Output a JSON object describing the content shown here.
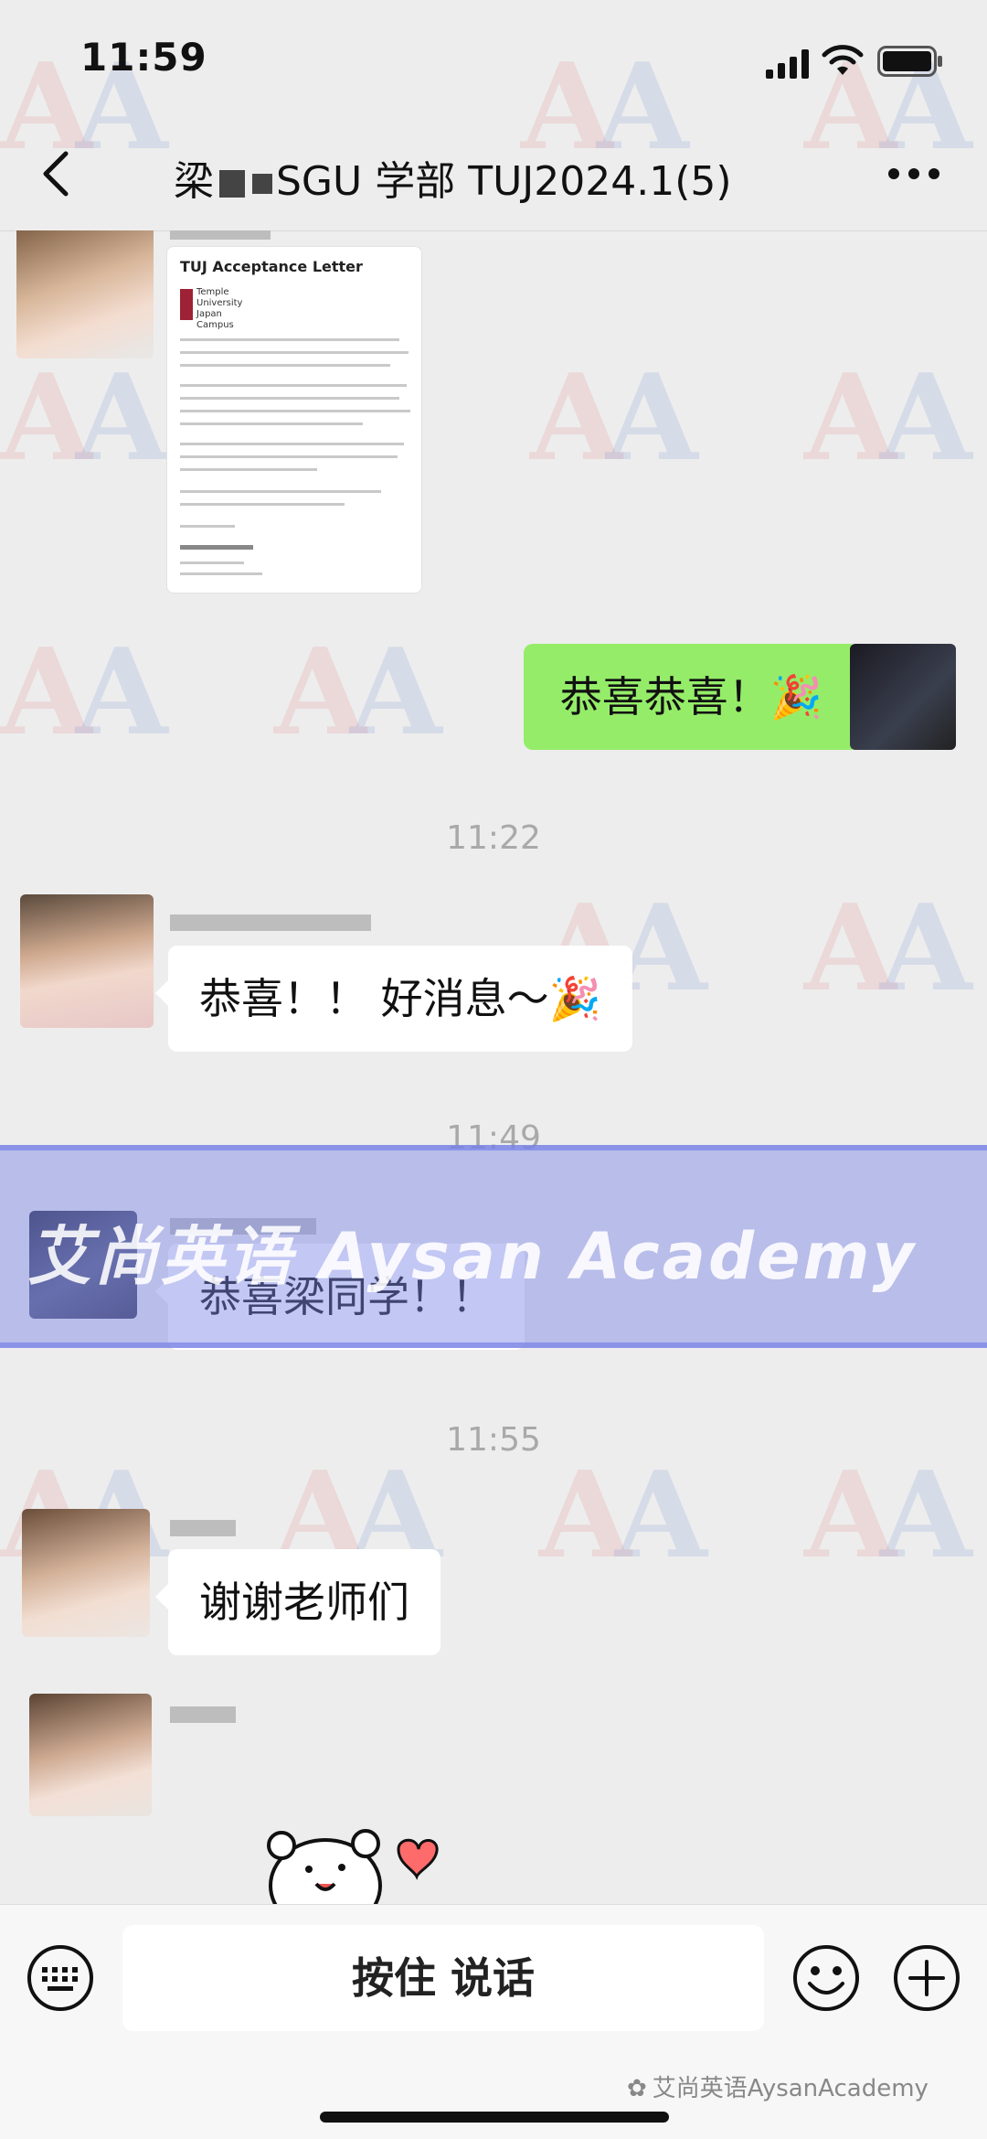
{
  "status_bar": {
    "time": "11:59"
  },
  "nav": {
    "title_prefix": "梁",
    "title_suffix": "SGU 学部 TUJ2024.1(5)"
  },
  "messages": {
    "doc_image": {
      "heading": "TUJ Acceptance Letter",
      "logo_text": "Temple University Japan Campus"
    },
    "self_msg": "恭喜恭喜！🎉",
    "time_1": "11:22",
    "msg_1": "恭喜！！ 好消息～🎉",
    "time_2": "11:49",
    "msg_2": "恭喜梁同学！！",
    "time_3": "11:55",
    "msg_3": "谢谢老师们"
  },
  "watermark_band": {
    "text": "艾尚英语 Aysan Academy"
  },
  "input_bar": {
    "hold_to_talk": "按住 说话",
    "footer_watermark": "艾尚英语AysanAcademy"
  },
  "icons": {
    "back": "chevron-left-icon",
    "more": "more-dots-icon",
    "keyboard": "keyboard-icon",
    "emoji": "smile-icon",
    "plus": "plus-circle-icon"
  },
  "colors": {
    "self_bubble": "#95ec69",
    "other_bubble": "#ffffff",
    "background": "#ededed"
  }
}
